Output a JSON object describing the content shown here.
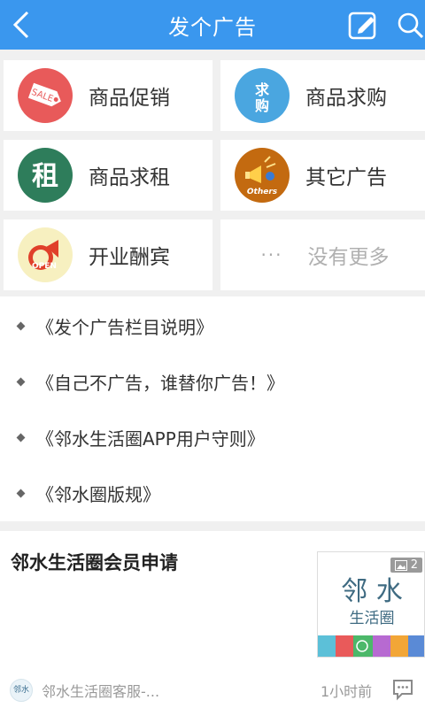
{
  "header": {
    "title": "发个广告"
  },
  "categories": [
    {
      "label": "商品促销",
      "icon": "sale-tag-icon",
      "icon_text": "SALE",
      "color": "#e85a5a"
    },
    {
      "label": "商品求购",
      "icon": "qiugou-icon",
      "icon_text": "求购",
      "color": "#4aa6e0"
    },
    {
      "label": "商品求租",
      "icon": "zu-icon",
      "icon_text": "租",
      "color": "#2e7d5b"
    },
    {
      "label": "其它广告",
      "icon": "megaphone-others-icon",
      "icon_text": "Others",
      "color": "#c36a10"
    },
    {
      "label": "开业酬宾",
      "icon": "open-megaphone-icon",
      "icon_text": "OPEN",
      "color": "#f7f0c0"
    },
    {
      "label": "没有更多",
      "icon": "more-dots-icon",
      "icon_text": "···"
    }
  ],
  "links": [
    "《发个广告栏目说明》",
    "《自己不广告，谁替你广告！》",
    "《邻水生活圈APP用户守则》",
    "《邻水圈版规》"
  ],
  "post": {
    "title": "邻水生活圈会员申请",
    "image_count": "2",
    "thumb_text_1": "邻 水",
    "thumb_text_2": "生活圈",
    "author": "邻水生活圈客服-...",
    "time": "1小时前",
    "avatar_text": "邻水"
  }
}
